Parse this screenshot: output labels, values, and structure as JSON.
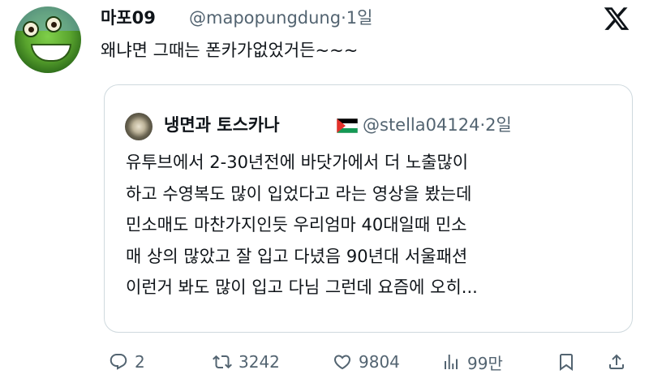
{
  "tweet": {
    "display_name": "마포09",
    "handle": "@mapopungdung",
    "separator": "·",
    "time": "1일",
    "text": "왜냐면 그때는 폰카가없었거든~~~",
    "avatar_icon": "green-dinosaur-avatar"
  },
  "quote": {
    "display_name": "냉면과 토스카나",
    "handle": "@stella04124",
    "separator": "·",
    "time": "2일",
    "flag_icon": "palestine-flag-icon",
    "lines": [
      "유투브에서 2-30년전에 바닷가에서 더 노출많이",
      "하고 수영복도 많이 입었다고 라는 영상을 봤는데",
      "민소매도 마찬가지인듯 우리엄마 40대일때 민소",
      "매 상의 많았고 잘 입고 다녔음 90년대 서울패션",
      "이런거 봐도 많이 입고 다님 그런데 요즘에 오히..."
    ]
  },
  "actions": {
    "replies": "2",
    "reposts": "3242",
    "likes": "9804",
    "views": "99만"
  },
  "colors": {
    "text": "#0f1419",
    "muted": "#536471",
    "border": "#cfd9de"
  }
}
